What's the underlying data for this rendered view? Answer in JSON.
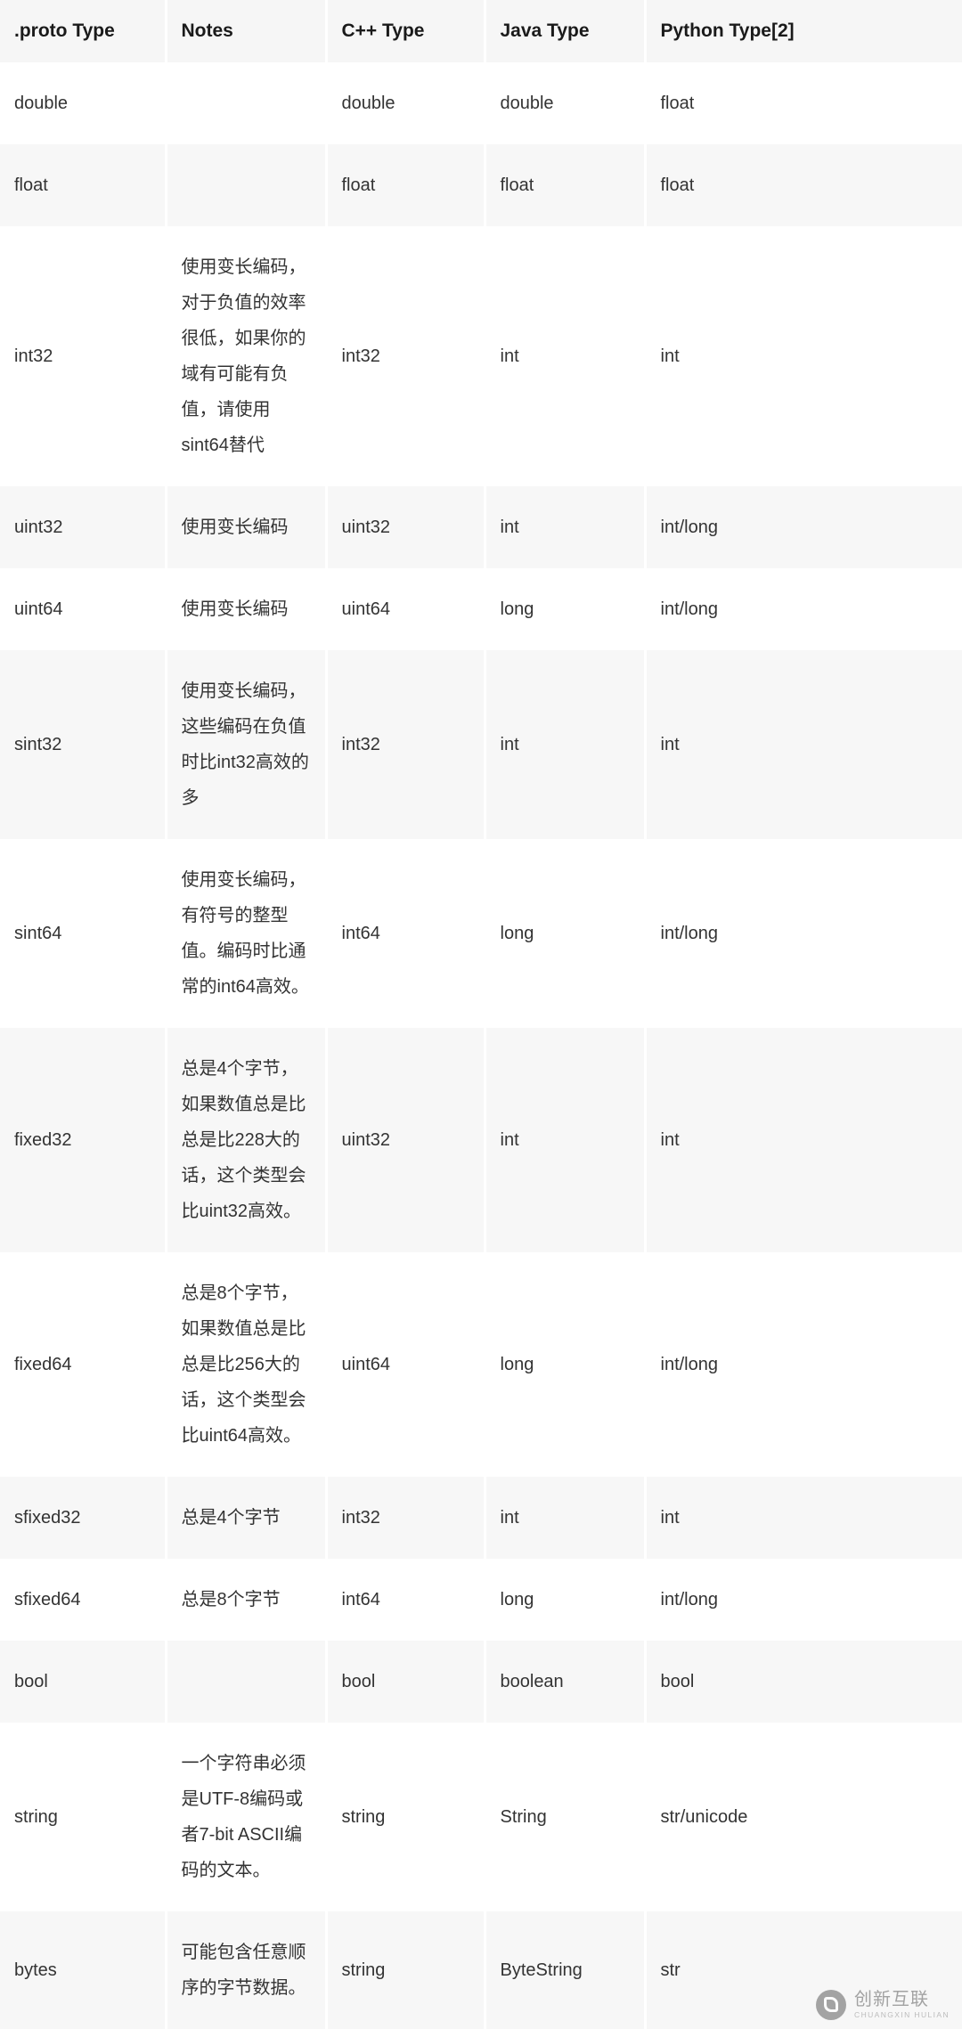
{
  "table": {
    "headers": [
      ".proto Type",
      "Notes",
      "C++ Type",
      "Java Type",
      "Python Type[2]"
    ],
    "rows": [
      {
        "proto": "double",
        "notes": "",
        "cpp": "double",
        "java": "double",
        "python": "float"
      },
      {
        "proto": "float",
        "notes": "",
        "cpp": "float",
        "java": "float",
        "python": "float"
      },
      {
        "proto": "int32",
        "notes": "使用变长编码，对于负值的效率很低，如果你的域有可能有负值，请使用sint64替代",
        "cpp": "int32",
        "java": "int",
        "python": "int"
      },
      {
        "proto": "uint32",
        "notes": "使用变长编码",
        "cpp": "uint32",
        "java": "int",
        "python": "int/long"
      },
      {
        "proto": "uint64",
        "notes": "使用变长编码",
        "cpp": "uint64",
        "java": "long",
        "python": "int/long"
      },
      {
        "proto": "sint32",
        "notes": "使用变长编码，这些编码在负值时比int32高效的多",
        "cpp": "int32",
        "java": "int",
        "python": "int"
      },
      {
        "proto": "sint64",
        "notes": "使用变长编码，有符号的整型值。编码时比通常的int64高效。",
        "cpp": "int64",
        "java": "long",
        "python": "int/long"
      },
      {
        "proto": "fixed32",
        "notes": "总是4个字节，如果数值总是比总是比228大的话，这个类型会比uint32高效。",
        "cpp": "uint32",
        "java": "int",
        "python": "int"
      },
      {
        "proto": "fixed64",
        "notes": "总是8个字节，如果数值总是比总是比256大的话，这个类型会比uint64高效。",
        "cpp": "uint64",
        "java": "long",
        "python": "int/long"
      },
      {
        "proto": "sfixed32",
        "notes": "总是4个字节",
        "cpp": "int32",
        "java": "int",
        "python": "int"
      },
      {
        "proto": "sfixed64",
        "notes": "总是8个字节",
        "cpp": "int64",
        "java": "long",
        "python": "int/long"
      },
      {
        "proto": "bool",
        "notes": "",
        "cpp": "bool",
        "java": "boolean",
        "python": "bool"
      },
      {
        "proto": "string",
        "notes": "一个字符串必须是UTF-8编码或者7-bit ASCII编码的文本。",
        "cpp": "string",
        "java": "String",
        "python": "str/unicode"
      },
      {
        "proto": "bytes",
        "notes": "可能包含任意顺序的字节数据。",
        "cpp": "string",
        "java": "ByteString",
        "python": "str"
      }
    ]
  },
  "watermark": {
    "cn": "创新互联",
    "en": "CHUANGXIN HULIAN"
  }
}
